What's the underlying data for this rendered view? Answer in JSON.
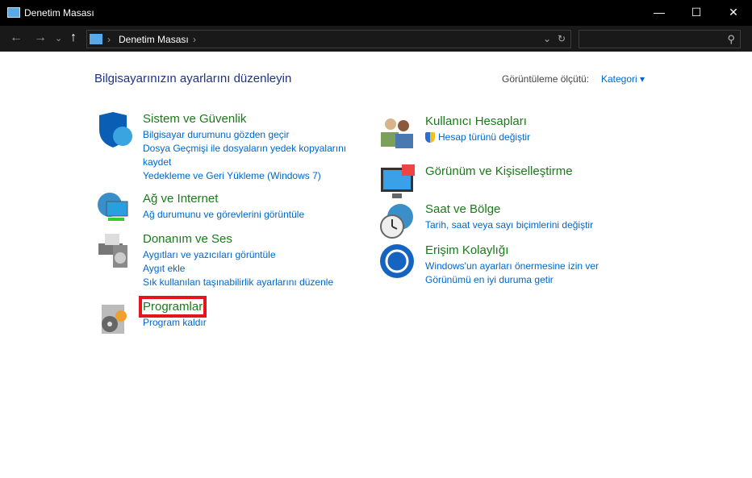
{
  "window": {
    "title": "Denetim Masası",
    "minimize": "—",
    "maximize": "☐",
    "close": "✕"
  },
  "nav": {
    "back": "←",
    "forward": "→",
    "recent": "⌄",
    "up": "↑",
    "breadcrumb": "Denetim Masası",
    "sep": "›",
    "refresh": "↻",
    "dropdown": "⌄",
    "search_icon": "⚲"
  },
  "main": {
    "heading": "Bilgisayarınızın ayarlarını düzenleyin",
    "view_by_label": "Görüntüleme ölçütü:",
    "view_by_value": "Kategori ▾"
  },
  "left": [
    {
      "title": "Sistem ve Güvenlik",
      "links": [
        "Bilgisayar durumunu gözden geçir",
        "Dosya Geçmişi ile dosyaların yedek kopyalarını",
        "kaydet",
        "Yedekleme ve Geri Yükleme (Windows 7)"
      ]
    },
    {
      "title": "Ağ ve Internet",
      "links": [
        "Ağ durumunu ve görevlerini görüntüle"
      ]
    },
    {
      "title": "Donanım ve Ses",
      "links": [
        "Aygıtları ve yazıcıları görüntüle",
        "Aygıt ekle",
        "Sık kullanılan taşınabilirlik ayarlarını düzenle"
      ]
    },
    {
      "title": "Programlar",
      "links": [
        "Program kaldır"
      ]
    }
  ],
  "right": [
    {
      "title": "Kullanıcı Hesapları",
      "links": [
        "Hesap türünü değiştir"
      ]
    },
    {
      "title": "Görünüm ve Kişiselleştirme",
      "links": []
    },
    {
      "title": "Saat ve Bölge",
      "links": [
        "Tarih, saat veya sayı biçimlerini değiştir"
      ]
    },
    {
      "title": "Erişim Kolaylığı",
      "links": [
        "Windows'un ayarları önermesine izin ver",
        "Görünümü en iyi duruma getir"
      ]
    }
  ]
}
